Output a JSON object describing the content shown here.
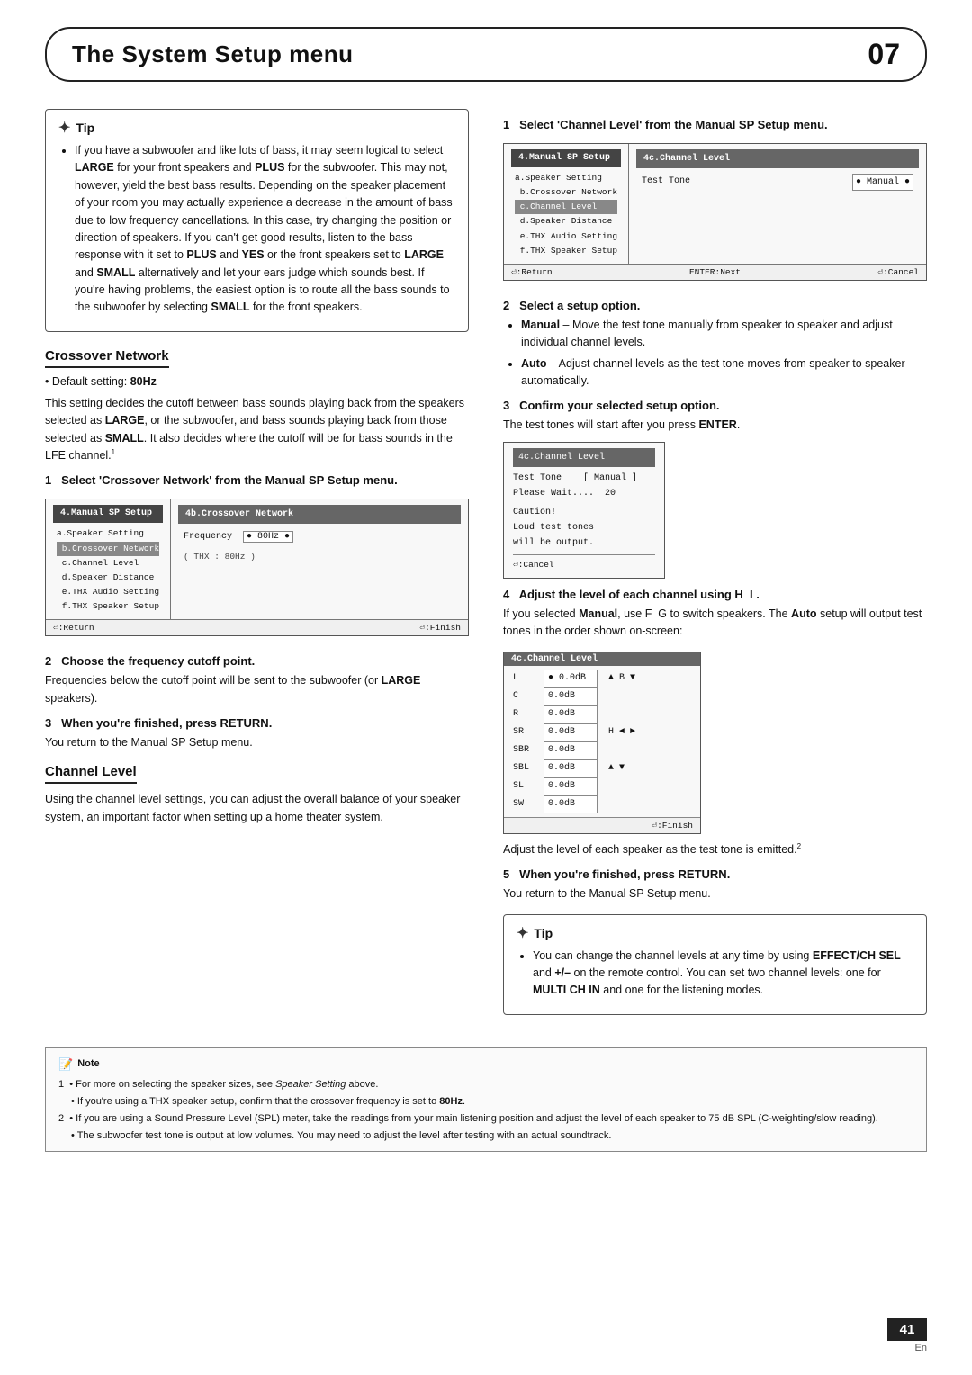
{
  "header": {
    "title": "The System Setup menu",
    "chapter": "07"
  },
  "left_tip": {
    "label": "Tip",
    "bullets": [
      "If you have a subwoofer and like lots of bass, it may seem logical to select LARGE for your front speakers and PLUS for the subwoofer. This may not, however, yield the best bass results. Depending on the speaker placement of your room you may actually experience a decrease in the amount of bass due to low frequency cancellations. In this case, try changing the position or direction of speakers. If you can't get good results, listen to the bass response with it set to PLUS and YES or the front speakers set to LARGE and SMALL alternatively and let your ears judge which sounds best. If you're having problems, the easiest option is to route all the bass sounds to the subwoofer by selecting SMALL for the front speakers."
    ]
  },
  "crossover": {
    "heading": "Crossover Network",
    "default": "Default setting: 80Hz",
    "body1": "This setting decides the cutoff between bass sounds playing back from the speakers selected as LARGE, or the subwoofer, and bass sounds playing back from those selected as SMALL. It also decides where the cutoff will be for bass sounds in the LFE channel.",
    "footnote": "1",
    "step1_heading": "1   Select 'Crossover Network' from the Manual SP Setup menu.",
    "screen1": {
      "left_title": "4.Manual SP Setup",
      "menu_items": [
        "a.Speaker Setting",
        "b.Crossover Network",
        "c.Channel Level",
        "d.Speaker Distance",
        "e.THX Audio Setting",
        "f.THX Speaker Setup"
      ],
      "highlight_index": 1,
      "right_title": "4b.Crossover Network",
      "right_content": "Frequency  ● 80Hz ●",
      "right_sub": "( THX : 80Hz )",
      "footer_left": "⏎:Return",
      "footer_right": "⏎:Finish"
    },
    "step2_heading": "2   Choose the frequency cutoff point.",
    "step2_body": "Frequencies below the cutoff point will be sent to the subwoofer (or LARGE speakers).",
    "step3_heading": "3   When you're finished, press RETURN.",
    "step3_body": "You return to the Manual SP Setup menu."
  },
  "channel_level": {
    "heading": "Channel Level",
    "body": "Using the channel level settings, you can adjust the overall balance of your speaker system, an important factor when setting up a home theater system."
  },
  "right_step1": {
    "heading": "1   Select 'Channel Level' from the Manual SP Setup menu.",
    "screen": {
      "left_title": "4.Manual SP Setup",
      "menu_items": [
        "a.Speaker Setting",
        "b.Crossover Network",
        "c.Channel Level",
        "d.Speaker Distance",
        "e.THX Audio Setting",
        "f.THX Speaker Setup"
      ],
      "highlight_index": 2,
      "right_title": "4c.Channel Level",
      "right_row1_label": "Test Tone",
      "right_row1_value": "● Manual ●",
      "footer_left": "⏎:Return",
      "footer_enter": "ENTER:Next",
      "footer_right": "⏎:Cancel"
    }
  },
  "right_step2": {
    "heading": "2   Select a setup option.",
    "manual_label": "Manual",
    "manual_desc": " – Move the test tone manually from speaker to speaker and adjust individual channel levels.",
    "auto_label": "Auto",
    "auto_desc": " – Adjust channel levels as the test tone moves from speaker to speaker automatically."
  },
  "right_step3": {
    "heading": "3   Confirm your selected setup option.",
    "body": "The test tones will start after you press ENTER.",
    "wait_screen": {
      "title": "4c.Channel Level",
      "row1": "Test Tone   [ Manual ]",
      "row2": "Please Wait....  20",
      "caution": "Caution!",
      "caution2": "Loud test tones",
      "caution3": "will be output.",
      "footer": "⏎:Cancel"
    }
  },
  "right_step4": {
    "heading": "4   Adjust the level of each channel using",
    "icons": "H  I",
    "body1": "If you selected Manual, use F  G to switch speakers. The Auto setup will output test tones in the order shown on-screen:",
    "ch_screen": {
      "title": "4c.Channel Level",
      "channels": [
        {
          "label": "L",
          "value": "● 0.0dB",
          "arrows": ""
        },
        {
          "label": "C",
          "value": "0.0dB",
          "arrows": "▲ B ▼"
        },
        {
          "label": "R",
          "value": "0.0dB",
          "arrows": ""
        },
        {
          "label": "SR",
          "value": "0.0dB",
          "arrows": ""
        },
        {
          "label": "SBR",
          "value": "0.0dB",
          "arrows": "H ◄ ►"
        },
        {
          "label": "SBL",
          "value": "0.0dB",
          "arrows": ""
        },
        {
          "label": "SL",
          "value": "0.0dB",
          "arrows": "▲ ▼"
        },
        {
          "label": "SW",
          "value": "0.0dB",
          "arrows": ""
        }
      ],
      "footer": "⏎:Finish"
    },
    "body2": "Adjust the level of each speaker as the test tone is emitted.",
    "footnote2": "2"
  },
  "right_step5": {
    "heading": "5   When you're finished, press RETURN.",
    "body": "You return to the Manual SP Setup menu."
  },
  "right_tip": {
    "label": "Tip",
    "bullets": [
      "You can change the channel levels at any time by using EFFECT/CH SEL and +/– on the remote control. You can set two channel levels: one for MULTI CH IN and one for the listening modes."
    ]
  },
  "note_box": {
    "label": "Note",
    "items": [
      "1  • For more on selecting the speaker sizes, see Speaker Setting above.",
      "     • If you're using a THX speaker setup, confirm that the crossover frequency is set to 80Hz.",
      "2  • If you are using a Sound Pressure Level (SPL) meter, take the readings from your main listening position and adjust the level of each speaker to 75 dB SPL (C-weighting/slow reading).",
      "     • The subwoofer test tone is output at low volumes. You may need to adjust the level after testing with an actual soundtrack."
    ]
  },
  "page_number": "41",
  "page_lang": "En"
}
